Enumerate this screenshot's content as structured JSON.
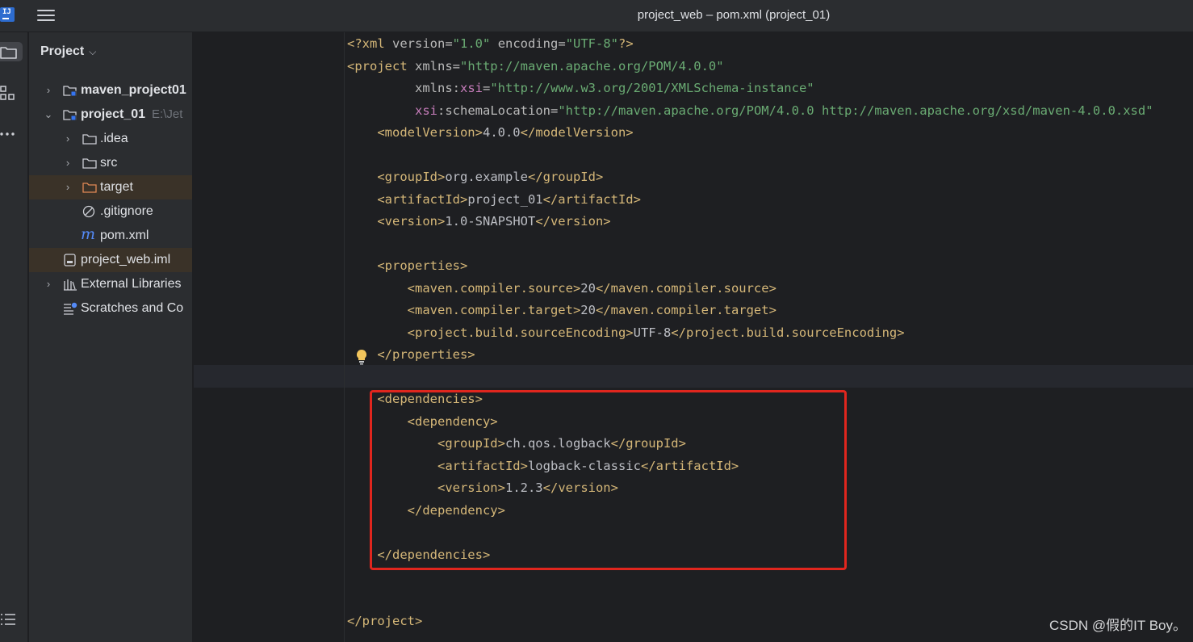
{
  "window": {
    "title": "project_web – pom.xml (project_01)"
  },
  "project_panel": {
    "title": "Project",
    "tree": [
      {
        "label": "maven_project01",
        "extra": "",
        "type": "module",
        "expanded": false
      },
      {
        "label": "project_01",
        "extra": "E:\\Jet",
        "type": "module",
        "expanded": true
      },
      {
        "label": ".idea",
        "type": "folder"
      },
      {
        "label": "src",
        "type": "folder"
      },
      {
        "label": "target",
        "type": "excluded-folder"
      },
      {
        "label": ".gitignore",
        "type": "ignore-file"
      },
      {
        "label": "pom.xml",
        "type": "maven-file"
      },
      {
        "label": "project_web.iml",
        "type": "iml-file"
      },
      {
        "label": "External Libraries",
        "type": "libraries"
      },
      {
        "label": "Scratches and Co",
        "type": "scratches"
      }
    ]
  },
  "editor": {
    "lines": [
      {
        "kind": "decl",
        "text": "<?xml version=\"1.0\" encoding=\"UTF-8\"?>"
      },
      {
        "kind": "open-project",
        "indent": 0,
        "tag": "project",
        "attr": "xmlns",
        "value": "\"http://maven.apache.org/POM/4.0.0\""
      },
      {
        "kind": "ns-attr",
        "indent": 9,
        "prefix": "xmlns",
        "name": "xsi",
        "value": "\"http://www.w3.org/2001/XMLSchema-instance\""
      },
      {
        "kind": "ns-attr",
        "indent": 9,
        "prefix": "xsi",
        "name": "schemaLocation",
        "value": "\"http://maven.apache.org/POM/4.0.0 http://maven.apache.org/xsd/maven-4.0.0.xsd\""
      },
      {
        "kind": "elem",
        "indent": 4,
        "tag": "modelVersion",
        "text": "4.0.0"
      },
      {
        "kind": "blank"
      },
      {
        "kind": "elem",
        "indent": 4,
        "tag": "groupId",
        "text": "org.example"
      },
      {
        "kind": "elem",
        "indent": 4,
        "tag": "artifactId",
        "text": "project_01"
      },
      {
        "kind": "elem",
        "indent": 4,
        "tag": "version",
        "text": "1.0-SNAPSHOT"
      },
      {
        "kind": "blank"
      },
      {
        "kind": "open",
        "indent": 4,
        "tag": "properties"
      },
      {
        "kind": "elem",
        "indent": 8,
        "tag": "maven.compiler.source",
        "text": "20"
      },
      {
        "kind": "elem",
        "indent": 8,
        "tag": "maven.compiler.target",
        "text": "20"
      },
      {
        "kind": "elem",
        "indent": 8,
        "tag": "project.build.sourceEncoding",
        "text": "UTF-8"
      },
      {
        "kind": "close",
        "indent": 4,
        "tag": "properties"
      },
      {
        "kind": "blank"
      },
      {
        "kind": "open",
        "indent": 4,
        "tag": "dependencies"
      },
      {
        "kind": "open",
        "indent": 8,
        "tag": "dependency"
      },
      {
        "kind": "elem",
        "indent": 12,
        "tag": "groupId",
        "text": "ch.qos.logback"
      },
      {
        "kind": "elem",
        "indent": 12,
        "tag": "artifactId",
        "text": "logback-classic"
      },
      {
        "kind": "elem",
        "indent": 12,
        "tag": "version",
        "text": "1.2.3"
      },
      {
        "kind": "close",
        "indent": 8,
        "tag": "dependency"
      },
      {
        "kind": "blank"
      },
      {
        "kind": "close",
        "indent": 4,
        "tag": "dependencies"
      },
      {
        "kind": "blank"
      },
      {
        "kind": "blank"
      },
      {
        "kind": "close",
        "indent": 0,
        "tag": "project"
      }
    ]
  },
  "watermark": "CSDN @假的IT Boy。"
}
